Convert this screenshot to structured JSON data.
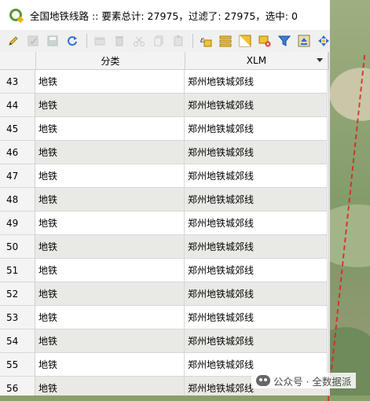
{
  "window": {
    "title": "全国地铁线路 :: 要素总计: 27975，过滤了: 27975，选中: 0"
  },
  "toolbar": {
    "icons": [
      "pencil-icon",
      "save-edits-icon",
      "disk-icon",
      "refresh-icon",
      "add-feature-icon",
      "delete-feature-icon",
      "cut-icon",
      "copy-icon",
      "paste-icon",
      "expression-select-icon",
      "select-all-icon",
      "invert-selection-icon",
      "deselect-icon",
      "filter-icon",
      "move-to-top-icon",
      "pan-to-selection-icon",
      "zoom-to-selection-icon"
    ]
  },
  "table": {
    "columns": [
      "分类",
      "XLM"
    ],
    "rows": [
      {
        "num": "43",
        "c1": "地铁",
        "c2": "郑州地铁城郊线"
      },
      {
        "num": "44",
        "c1": "地铁",
        "c2": "郑州地铁城郊线"
      },
      {
        "num": "45",
        "c1": "地铁",
        "c2": "郑州地铁城郊线"
      },
      {
        "num": "46",
        "c1": "地铁",
        "c2": "郑州地铁城郊线"
      },
      {
        "num": "47",
        "c1": "地铁",
        "c2": "郑州地铁城郊线"
      },
      {
        "num": "48",
        "c1": "地铁",
        "c2": "郑州地铁城郊线"
      },
      {
        "num": "49",
        "c1": "地铁",
        "c2": "郑州地铁城郊线"
      },
      {
        "num": "50",
        "c1": "地铁",
        "c2": "郑州地铁城郊线"
      },
      {
        "num": "51",
        "c1": "地铁",
        "c2": "郑州地铁城郊线"
      },
      {
        "num": "52",
        "c1": "地铁",
        "c2": "郑州地铁城郊线"
      },
      {
        "num": "53",
        "c1": "地铁",
        "c2": "郑州地铁城郊线"
      },
      {
        "num": "54",
        "c1": "地铁",
        "c2": "郑州地铁城郊线"
      },
      {
        "num": "55",
        "c1": "地铁",
        "c2": "郑州地铁城郊线"
      },
      {
        "num": "56",
        "c1": "地铁",
        "c2": "郑州地铁城郊线"
      }
    ]
  },
  "watermark": {
    "text": "公众号 · 全数据派"
  },
  "colors": {
    "qgis_green": "#589632",
    "alt_row": "#e9e9e6",
    "map_line": "#dd2222"
  }
}
